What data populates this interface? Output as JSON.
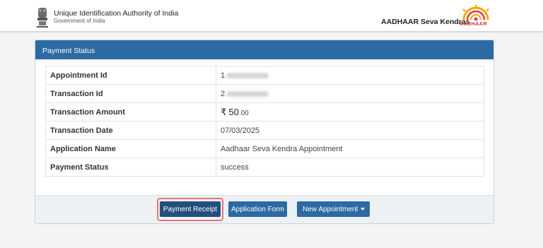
{
  "header": {
    "org_name": "Unique Identification Authority of India",
    "org_sub": "Government of India",
    "brand": "AADHAAR Seva Kendras",
    "logo_text": "AADHAAR"
  },
  "panel": {
    "title": "Payment Status",
    "rows": [
      {
        "label": "Appointment Id",
        "value": "1"
      },
      {
        "label": "Transaction Id",
        "value": "2"
      },
      {
        "label": "Transaction Amount",
        "currency": "₹",
        "amount": "50",
        "decimals": ".00"
      },
      {
        "label": "Transaction Date",
        "value": "07/03/2025"
      },
      {
        "label": "Application Name",
        "value": "Aadhaar Seva Kendra Appointment"
      },
      {
        "label": "Payment Status",
        "value": "success"
      }
    ]
  },
  "footer": {
    "receipt_label": "Payment Receipt",
    "form_label": "Application Form",
    "new_label": "New Appointment"
  },
  "colors": {
    "panel_header": "#2c6aa3",
    "button": "#2c6aa3",
    "highlight": "#e87575"
  }
}
